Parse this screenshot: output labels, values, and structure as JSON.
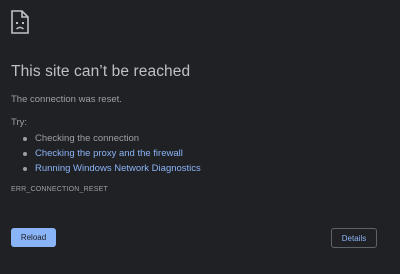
{
  "icon": {
    "name": "sad-document-icon",
    "color": "#bdc1c6"
  },
  "error": {
    "title": "This site can’t be reached",
    "message": "The connection was reset.",
    "code": "ERR_CONNECTION_RESET"
  },
  "suggestions": {
    "label": "Try:",
    "items": [
      {
        "text": "Checking the connection",
        "is_link": false
      },
      {
        "text": "Checking the proxy and the firewall",
        "is_link": true
      },
      {
        "text": "Running Windows Network Diagnostics",
        "is_link": true
      }
    ]
  },
  "buttons": {
    "reload_label": "Reload",
    "details_label": "Details"
  },
  "colors": {
    "background": "#202124",
    "title": "#bdc1c6",
    "body_text": "#9aa0a6",
    "link": "#8ab4f8",
    "primary_button": "#8ab4f8",
    "secondary_border": "#5f6368"
  }
}
